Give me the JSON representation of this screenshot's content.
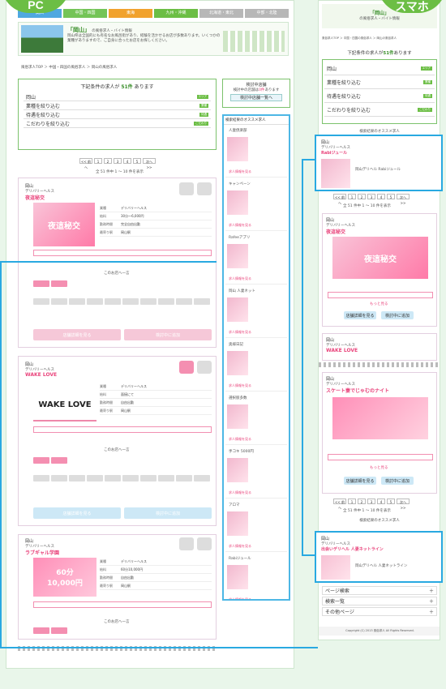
{
  "labels": {
    "pc": "PC",
    "sp": "スマホ"
  },
  "pc": {
    "tabs": [
      {
        "label": "関西",
        "color": "#4fa8e0"
      },
      {
        "label": "中国・四国",
        "color": "#74c457"
      },
      {
        "label": "東海",
        "color": "#f1a22e"
      },
      {
        "label": "九州・沖縄",
        "color": "#6cbe45"
      },
      {
        "label": "北海道・東北",
        "color": "#b7b7b7"
      },
      {
        "label": "中部・北陸",
        "color": "#b7b7b7"
      }
    ],
    "header_title": "「岡山」",
    "header_sub": "の風俗求人・バイト情報",
    "intro": "岡山県は全国的にも有名なお風呂街があり、経験を活かせるお店が多数あります。いくつかの業種がありますので、ご自身に合ったお店をお探しください。",
    "breadcrumb": "風俗求人TOP ＞ 中国・四国の風俗求人 ＞ 岡山の風俗求人",
    "result": {
      "prefix": "下記条件の求人が",
      "count": "51件",
      "suffix": "あります"
    },
    "filters": [
      {
        "label": "岡山",
        "tag": "エリア"
      },
      {
        "label": "業種を絞り込む",
        "tag": "業種"
      },
      {
        "label": "待遇を絞り込む",
        "tag": "待遇"
      },
      {
        "label": "こだわりを絞り込む",
        "tag": "こだわり"
      }
    ],
    "consider": {
      "title": "検討中店舗",
      "sub": "検討中の店舗は",
      "count": "0件",
      "sub2": "あります",
      "btn": "検討中店舗一覧へ"
    },
    "pages": [
      "<< 前へ",
      "1",
      "2",
      "3",
      "4",
      "5",
      "次へ >>"
    ],
    "page_info": "全 51 件中 1 ～ 10 件を表示",
    "shops": [
      {
        "area": "岡山",
        "genre": "デリバリーヘルス",
        "name": "夜這秘交",
        "banner": "夜這秘交",
        "banner2": "最大30000円",
        "info": [
          [
            "業種",
            "デリバリーヘルス"
          ],
          [
            "給料",
            "30分～6,000円"
          ],
          [
            "勤務時間",
            "完全自由出勤"
          ],
          [
            "最寄り駅",
            "岡山駅"
          ]
        ],
        "detail": "店舗詳細を見る",
        "add": "検討中に追加",
        "more": "このお店へ一言"
      },
      {
        "area": "岡山",
        "genre": "デリバリーヘルス",
        "name": "WAKE LOVE",
        "banner": "WAKE LOVE",
        "banner2": "",
        "info": [
          [
            "業種",
            "デリバリーヘルス"
          ],
          [
            "給料",
            "面接にて"
          ],
          [
            "勤務時間",
            "自由出勤"
          ],
          [
            "最寄り駅",
            "岡山駅"
          ]
        ],
        "detail": "店舗詳細を見る",
        "add": "検討中に追加",
        "more": "このお店へ一言"
      },
      {
        "area": "岡山",
        "genre": "デリバリーヘルス",
        "name": "ラブギャル学園",
        "banner": "60分",
        "banner2": "10,000円",
        "info": [
          [
            "業種",
            "デリバリーヘルス"
          ],
          [
            "給料",
            "60分10,000円"
          ],
          [
            "勤務時間",
            "自由出勤"
          ],
          [
            "最寄り駅",
            "岡山駅"
          ]
        ],
        "detail": "店舗詳細を見る",
        "add": "検討中に追加",
        "more": "このお店へ一言"
      }
    ],
    "side_title": "検索結果のオススメ求人",
    "side_items": [
      {
        "name": "人妻倶楽部",
        "link": "求人情報を見る"
      },
      {
        "name": "キャンペーン",
        "link": "求人情報を見る"
      },
      {
        "name": "Rafeeアプリ",
        "link": "求人情報を見る"
      },
      {
        "name": "岡山 人妻ネット",
        "link": "求人情報を見る"
      },
      {
        "name": "奥様日記",
        "link": "求人情報を見る"
      },
      {
        "name": "選択肢多数",
        "link": "求人情報を見る"
      },
      {
        "name": "手コキ 5000円",
        "link": "求人情報を見る"
      },
      {
        "name": "アロマ",
        "link": "求人情報を見る"
      },
      {
        "name": "Rabiジュール",
        "link": "求人情報を見る"
      }
    ]
  },
  "sp": {
    "header_title": "「岡山」",
    "header_sub": "の風俗求人・バイト情報",
    "breadcrumb": "風俗求人TOP ＞ 中国・四国の風俗求人 ＞ 岡山の風俗求人",
    "result": {
      "prefix": "下記条件の求人が",
      "count": "51件",
      "suffix": "あります"
    },
    "filters": [
      {
        "label": "岡山",
        "tag": "エリア"
      },
      {
        "label": "業種を絞り込む",
        "tag": "業種"
      },
      {
        "label": "待遇を絞り込む",
        "tag": "待遇"
      },
      {
        "label": "こだわりを絞り込む",
        "tag": "こだわり"
      }
    ],
    "reco_title": "検索結果のオススメ求人",
    "reco1": {
      "area": "岡山",
      "genre": "デリバリーヘルス",
      "name": "Rabiジュール",
      "text": "岡山デリヘル Rabiジュール"
    },
    "reco2": {
      "area": "岡山",
      "genre": "デリバリーヘルス",
      "name": "出会いデリヘル 人妻ネットライン",
      "text": "岡山デリヘル 人妻ネットライン"
    },
    "shop1": {
      "area": "岡山",
      "genre": "デリバリーヘルス",
      "name": "夜這秘交",
      "more": "もっと見る",
      "detail": "店舗詳細を見る",
      "add": "検討中に追加"
    },
    "shop2": {
      "area": "岡山",
      "genre": "デリバリーヘルス",
      "name": "WAKE LOVE"
    },
    "shop3": {
      "area": "岡山",
      "genre": "デリバリーヘルス",
      "name": "スケート妻でじゃむのナイト",
      "more": "もっと見る",
      "detail": "店舗詳細を見る",
      "add": "検討中に追加"
    },
    "pages": [
      "<< 前へ",
      "1",
      "2",
      "3",
      "4",
      "5",
      "次へ >>"
    ],
    "page_info": "全 51 件中 1 ～ 10 件を表示",
    "footer_links": [
      "ページ検索",
      "検索一覧",
      "その他ページ"
    ],
    "copyright": "Copyright (C) 2013 風俗求人 All Rights Reserved."
  }
}
